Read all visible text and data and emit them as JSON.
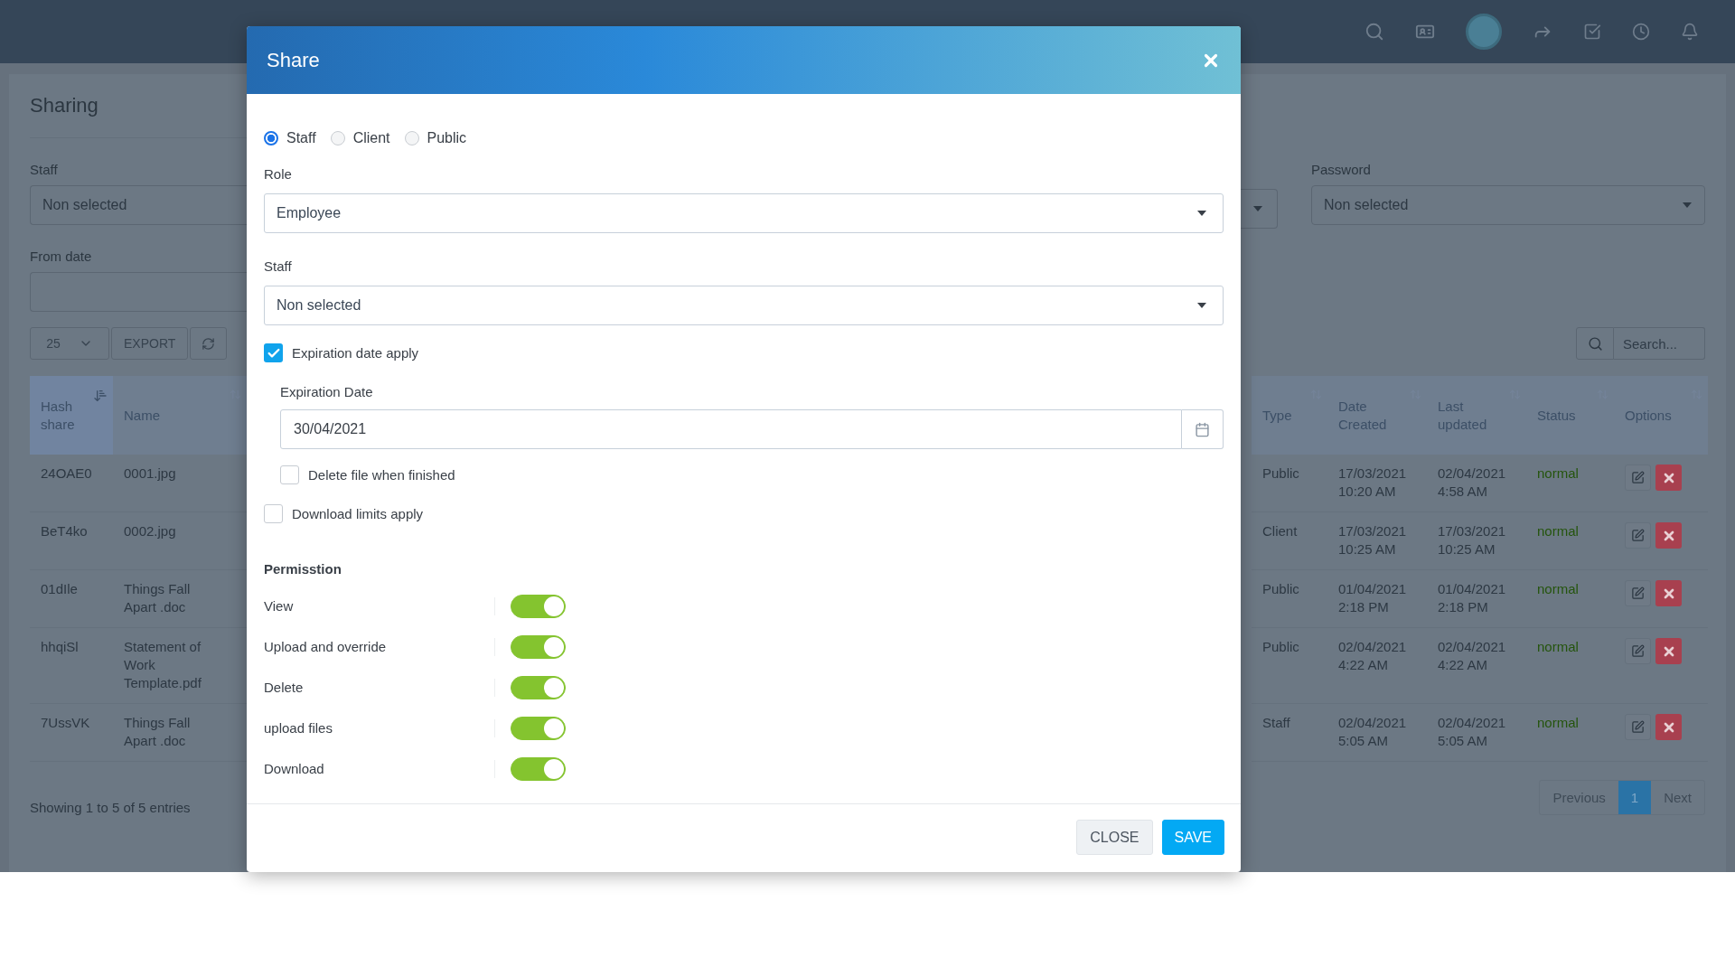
{
  "page": {
    "title": "Sharing"
  },
  "filters_left": [
    {
      "label": "Staff",
      "kind": "select",
      "value": "Non selected"
    },
    {
      "label": "From date",
      "kind": "date"
    }
  ],
  "filters_right": [
    {
      "label": "Password",
      "kind": "select",
      "value": "Non selected"
    }
  ],
  "toolbar": {
    "page_size": "25",
    "export": "EXPORT",
    "search_placeholder": "Search..."
  },
  "table": {
    "columns": [
      {
        "label": "Hash share",
        "sorted": true
      },
      {
        "label": "Name",
        "sorted": false
      },
      {
        "label": "Type",
        "sorted": false
      },
      {
        "label": "Date Created",
        "sorted": false
      },
      {
        "label": "Last updated",
        "sorted": false
      },
      {
        "label": "Status",
        "sorted": false
      },
      {
        "label": "Options",
        "sorted": false
      }
    ],
    "rows": [
      {
        "hash": "24OAE0",
        "name": "0001.jpg",
        "type": "Public",
        "created": "17/03/2021 10:20 AM",
        "updated": "02/04/2021 4:58 AM",
        "status": "normal"
      },
      {
        "hash": "BeT4ko",
        "name": "0002.jpg",
        "type": "Client",
        "created": "17/03/2021 10:25 AM",
        "updated": "17/03/2021 10:25 AM",
        "status": "normal"
      },
      {
        "hash": "01dIle",
        "name": "Things Fall Apart .doc",
        "type": "Public",
        "created": "01/04/2021 2:18 PM",
        "updated": "01/04/2021 2:18 PM",
        "status": "normal"
      },
      {
        "hash": "hhqiSl",
        "name": "Statement of Work Template.pdf",
        "type": "Public",
        "created": "02/04/2021 4:22 AM",
        "updated": "02/04/2021 4:22 AM",
        "status": "normal"
      },
      {
        "hash": "7UssVK",
        "name": "Things Fall Apart .doc",
        "type": "Staff",
        "created": "02/04/2021 5:05 AM",
        "updated": "02/04/2021 5:05 AM",
        "status": "normal"
      }
    ]
  },
  "footer": {
    "info": "Showing 1 to 5 of 5 entries",
    "pages": [
      {
        "label": "Previous",
        "selected": false
      },
      {
        "label": "1",
        "selected": true
      },
      {
        "label": "Next",
        "selected": false
      }
    ]
  },
  "modal": {
    "title": "Share",
    "audience": [
      {
        "label": "Staff",
        "selected": true
      },
      {
        "label": "Client",
        "selected": false
      },
      {
        "label": "Public",
        "selected": false
      }
    ],
    "selects": [
      {
        "label": "Role",
        "value": "Employee"
      },
      {
        "label": "Staff",
        "value": "Non selected"
      }
    ],
    "expiration_apply": {
      "label": "Expiration date apply",
      "checked": true
    },
    "expiration_date": {
      "label": "Expiration Date",
      "value": "30/04/2021"
    },
    "delete_file": {
      "label": "Delete file when finished",
      "checked": false
    },
    "download_limits": {
      "label": "Download limits apply",
      "checked": false
    },
    "permissions": {
      "title": "Permisstion",
      "items": [
        {
          "label": "View",
          "on": true
        },
        {
          "label": "Upload and override",
          "on": true
        },
        {
          "label": "Delete",
          "on": true
        },
        {
          "label": "upload files",
          "on": true
        },
        {
          "label": "Download",
          "on": true
        }
      ]
    },
    "buttons": [
      {
        "label": "CLOSE",
        "kind": "secondary"
      },
      {
        "label": "SAVE",
        "kind": "primary"
      }
    ]
  }
}
